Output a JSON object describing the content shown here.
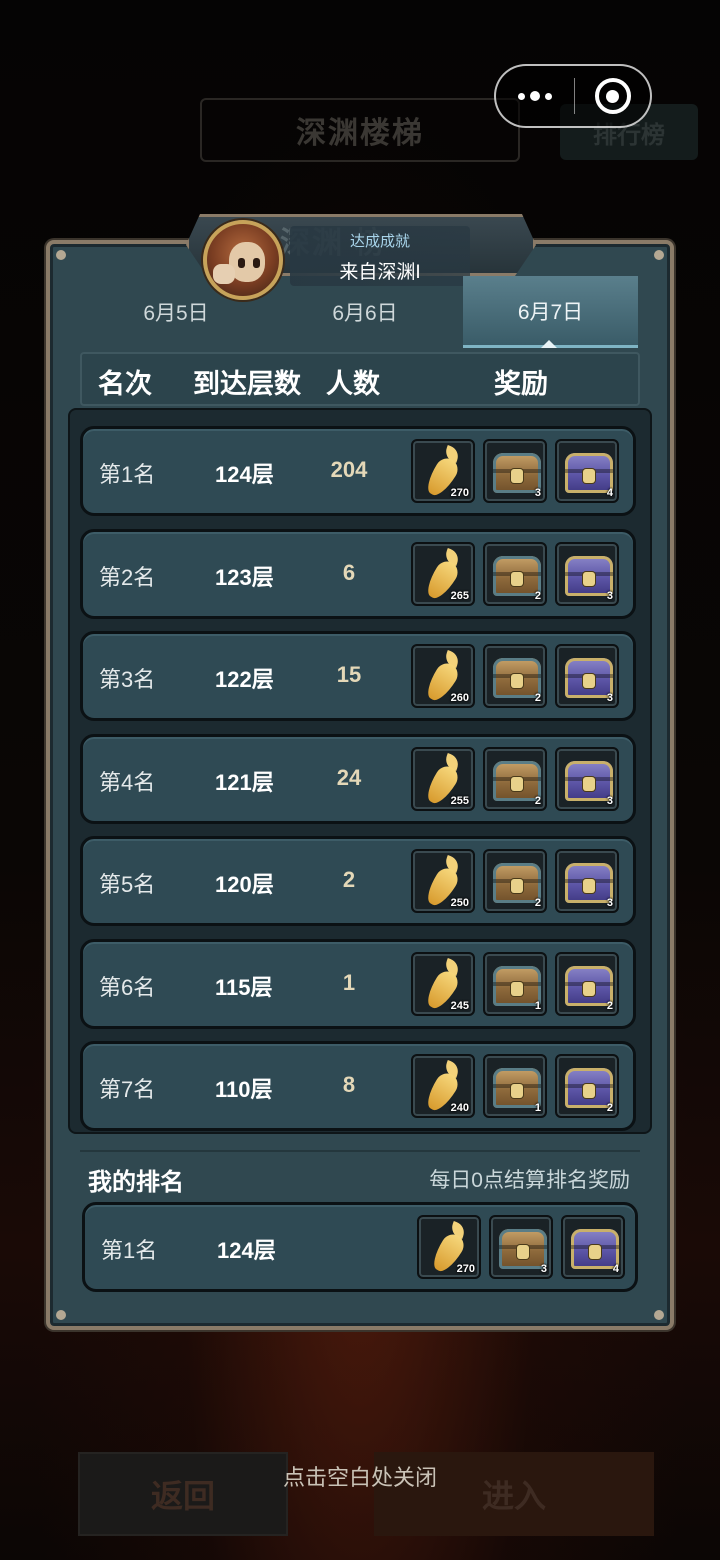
{
  "background": {
    "title": "深渊楼梯",
    "rank_button": "排行榜",
    "back_button": "返回",
    "enter_button": "进入"
  },
  "close_hint": "点击空白处关闭",
  "header": {
    "watermark_title": "深渊 榜",
    "achievement_label": "达成成就",
    "achievement_name": "来自深渊I"
  },
  "tabs": [
    {
      "label": "6月5日",
      "active": false
    },
    {
      "label": "6月6日",
      "active": false
    },
    {
      "label": "6月7日",
      "active": true
    }
  ],
  "columns": {
    "rank": "名次",
    "floor": "到达层数",
    "count": "人数",
    "reward": "奖励"
  },
  "rows": [
    {
      "rank": "第1名",
      "floor": "124层",
      "count": "204",
      "rewards": [
        "270",
        "3",
        "4"
      ]
    },
    {
      "rank": "第2名",
      "floor": "123层",
      "count": "6",
      "rewards": [
        "265",
        "2",
        "3"
      ]
    },
    {
      "rank": "第3名",
      "floor": "122层",
      "count": "15",
      "rewards": [
        "260",
        "2",
        "3"
      ]
    },
    {
      "rank": "第4名",
      "floor": "121层",
      "count": "24",
      "rewards": [
        "255",
        "2",
        "3"
      ]
    },
    {
      "rank": "第5名",
      "floor": "120层",
      "count": "2",
      "rewards": [
        "250",
        "2",
        "3"
      ]
    },
    {
      "rank": "第6名",
      "floor": "115层",
      "count": "1",
      "rewards": [
        "245",
        "1",
        "2"
      ]
    },
    {
      "rank": "第7名",
      "floor": "110层",
      "count": "8",
      "rewards": [
        "240",
        "1",
        "2"
      ]
    }
  ],
  "reward_icons": [
    "carrot-icon",
    "gold-chest-icon",
    "purple-chest-icon"
  ],
  "my_rank": {
    "title": "我的排名",
    "note": "每日0点结算排名奖励",
    "rank": "第1名",
    "floor": "124层",
    "rewards": [
      "270",
      "3",
      "4"
    ]
  }
}
